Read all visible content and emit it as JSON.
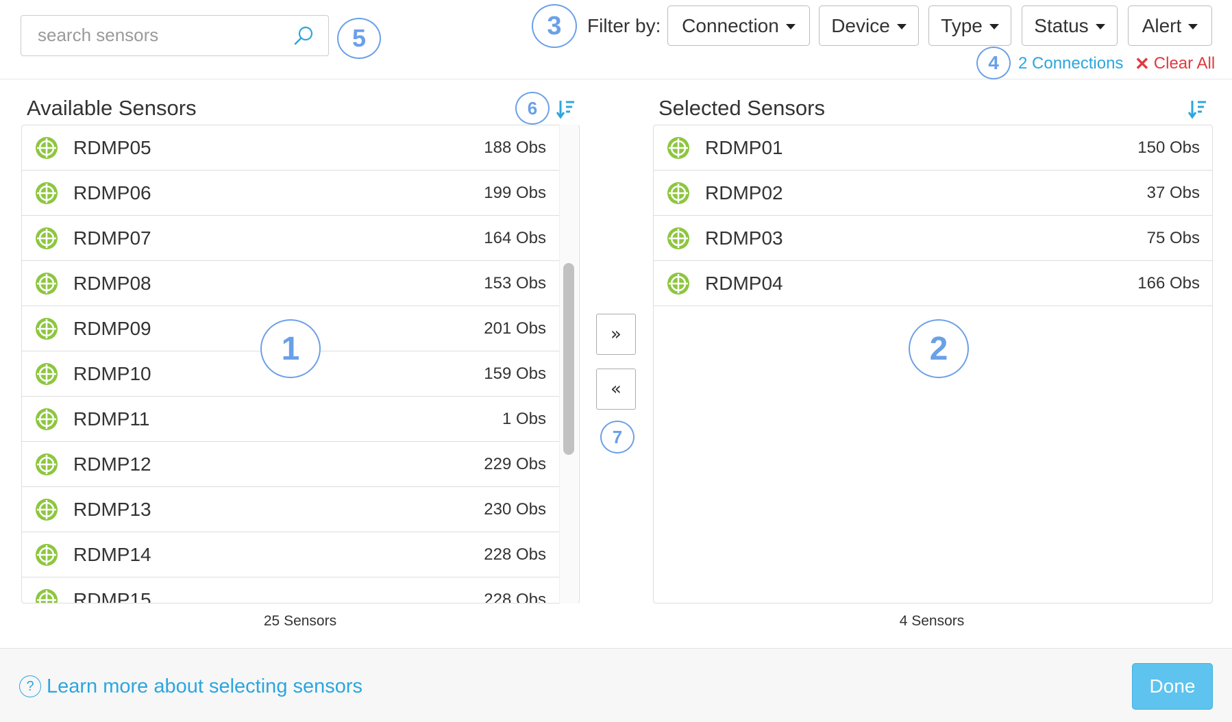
{
  "search": {
    "placeholder": "search sensors",
    "icon": "magnifier-icon"
  },
  "filters": {
    "label": "Filter by:",
    "buttons": [
      {
        "label": "Connection"
      },
      {
        "label": "Device"
      },
      {
        "label": "Type"
      },
      {
        "label": "Status"
      },
      {
        "label": "Alert"
      }
    ],
    "connections_link": "2 Connections",
    "clear_all": "Clear All",
    "clear_icon": "✕"
  },
  "callouts": {
    "c1": "1",
    "c2": "2",
    "c3": "3",
    "c4": "4",
    "c5": "5",
    "c6": "6",
    "c7": "7"
  },
  "available": {
    "title": "Available Sensors",
    "count": "25 Sensors",
    "rows": [
      {
        "name": "RDMP05",
        "obs": "188 Obs"
      },
      {
        "name": "RDMP06",
        "obs": "199 Obs"
      },
      {
        "name": "RDMP07",
        "obs": "164 Obs"
      },
      {
        "name": "RDMP08",
        "obs": "153 Obs"
      },
      {
        "name": "RDMP09",
        "obs": "201 Obs"
      },
      {
        "name": "RDMP10",
        "obs": "159 Obs"
      },
      {
        "name": "RDMP11",
        "obs": "1 Obs"
      },
      {
        "name": "RDMP12",
        "obs": "229 Obs"
      },
      {
        "name": "RDMP13",
        "obs": "230 Obs"
      },
      {
        "name": "RDMP14",
        "obs": "228 Obs"
      },
      {
        "name": "RDMP15",
        "obs": "228 Obs"
      }
    ]
  },
  "selected": {
    "title": "Selected Sensors",
    "count": "4 Sensors",
    "rows": [
      {
        "name": "RDMP01",
        "obs": "150 Obs"
      },
      {
        "name": "RDMP02",
        "obs": "37 Obs"
      },
      {
        "name": "RDMP03",
        "obs": "75 Obs"
      },
      {
        "name": "RDMP04",
        "obs": "166 Obs"
      }
    ]
  },
  "transfer": {
    "add_label": "»",
    "remove_label": "«"
  },
  "footer": {
    "help_icon": "?",
    "help_link": "Learn more about selecting sensors",
    "done_label": "Done"
  },
  "colors": {
    "accent": "#2ba6de",
    "danger": "#e0393e",
    "sensor_icon": "#8dc63f",
    "callout": "#6aa0e8",
    "done": "#5ec3ee"
  }
}
